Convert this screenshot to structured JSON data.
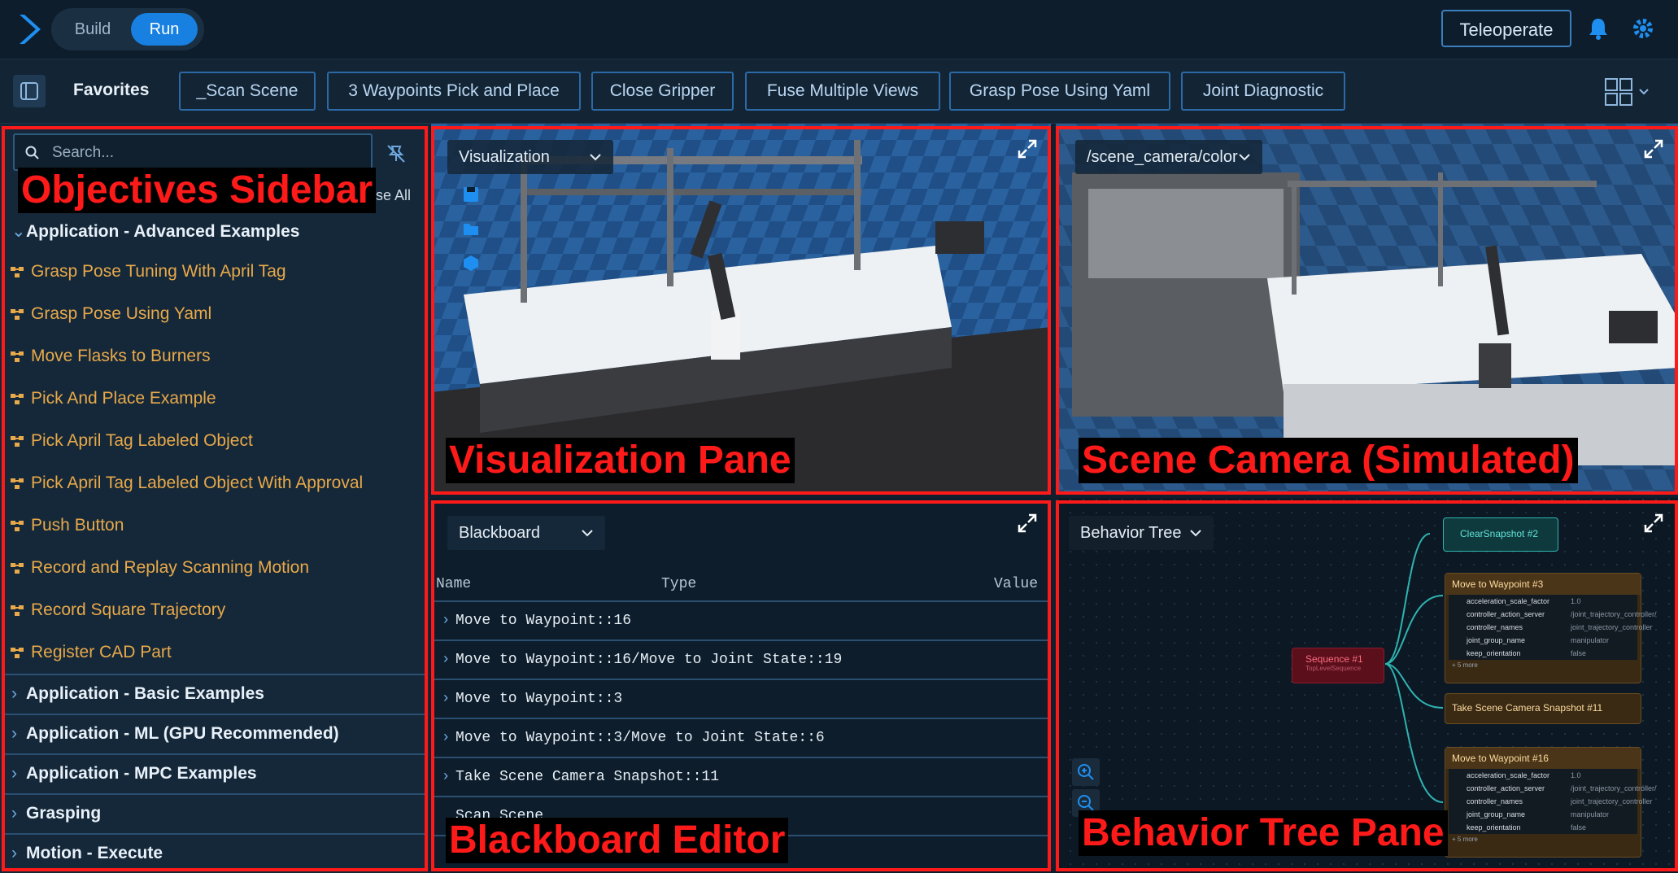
{
  "topbar": {
    "mode_build": "Build",
    "mode_run": "Run",
    "teleoperate": "Teleoperate"
  },
  "favorites": {
    "label": "Favorites",
    "items": [
      "_Scan Scene",
      "3 Waypoints Pick and Place",
      "Close Gripper",
      "Fuse Multiple Views",
      "Grasp Pose Using Yaml",
      "Joint Diagnostic"
    ]
  },
  "sidebar": {
    "search_placeholder": "Search...",
    "collapse_all": "se All",
    "expanded_group": "Application - Advanced Examples",
    "objectives": [
      "Grasp Pose Tuning With April Tag",
      "Grasp Pose Using Yaml",
      "Move Flasks to Burners",
      "Pick And Place Example",
      "Pick April Tag Labeled Object",
      "Pick April Tag Labeled Object With Approval",
      "Push Button",
      "Record and Replay Scanning Motion",
      "Record Square Trajectory",
      "Register CAD Part"
    ],
    "categories": [
      "Application - Basic Examples",
      "Application - ML (GPU Recommended)",
      "Application - MPC Examples",
      "Grasping",
      "Motion - Execute"
    ]
  },
  "viz": {
    "dropdown": "Visualization"
  },
  "camera": {
    "dropdown": "/scene_camera/color"
  },
  "blackboard": {
    "dropdown": "Blackboard",
    "columns": {
      "name": "Name",
      "type": "Type",
      "value": "Value"
    },
    "rows": [
      "Move to Waypoint::16",
      "Move to Waypoint::16/Move to Joint State::19",
      "Move to Waypoint::3",
      "Move to Waypoint::3/Move to Joint State::6",
      "Take Scene Camera Snapshot::11",
      "Scan Scene"
    ]
  },
  "behavior_tree": {
    "dropdown": "Behavior Tree",
    "sequence": {
      "title": "Sequence #1",
      "subtitle": "TopLevelSequence"
    },
    "clear_snapshot": "ClearSnapshot #2",
    "take_snapshot": "Take Scene Camera Snapshot #11",
    "waypoint_a": {
      "title": "Move to Waypoint #3",
      "ports": [
        {
          "name": "acceleration_scale_factor",
          "value": "1.0"
        },
        {
          "name": "controller_action_server",
          "value": "/joint_trajectory_controller/"
        },
        {
          "name": "controller_names",
          "value": "joint_trajectory_controller"
        },
        {
          "name": "joint_group_name",
          "value": "manipulator"
        },
        {
          "name": "keep_orientation",
          "value": "false"
        }
      ],
      "more": "+ 5 more"
    },
    "waypoint_b": {
      "title": "Move to Waypoint #16",
      "ports": [
        {
          "name": "acceleration_scale_factor",
          "value": "1.0"
        },
        {
          "name": "controller_action_server",
          "value": "/joint_trajectory_controller/"
        },
        {
          "name": "controller_names",
          "value": "joint_trajectory_controller"
        },
        {
          "name": "joint_group_name",
          "value": "manipulator"
        },
        {
          "name": "keep_orientation",
          "value": "false"
        }
      ],
      "more": "+ 5 more"
    }
  },
  "callouts": {
    "sidebar": "Objectives Sidebar",
    "viz": "Visualization Pane",
    "camera": "Scene Camera (Simulated)",
    "blackboard": "Blackboard Editor",
    "bt": "Behavior Tree Pane"
  },
  "colors": {
    "accent": "#1780e0",
    "callout_red": "#ff1a1a",
    "objective_orange": "#e8a94a"
  }
}
